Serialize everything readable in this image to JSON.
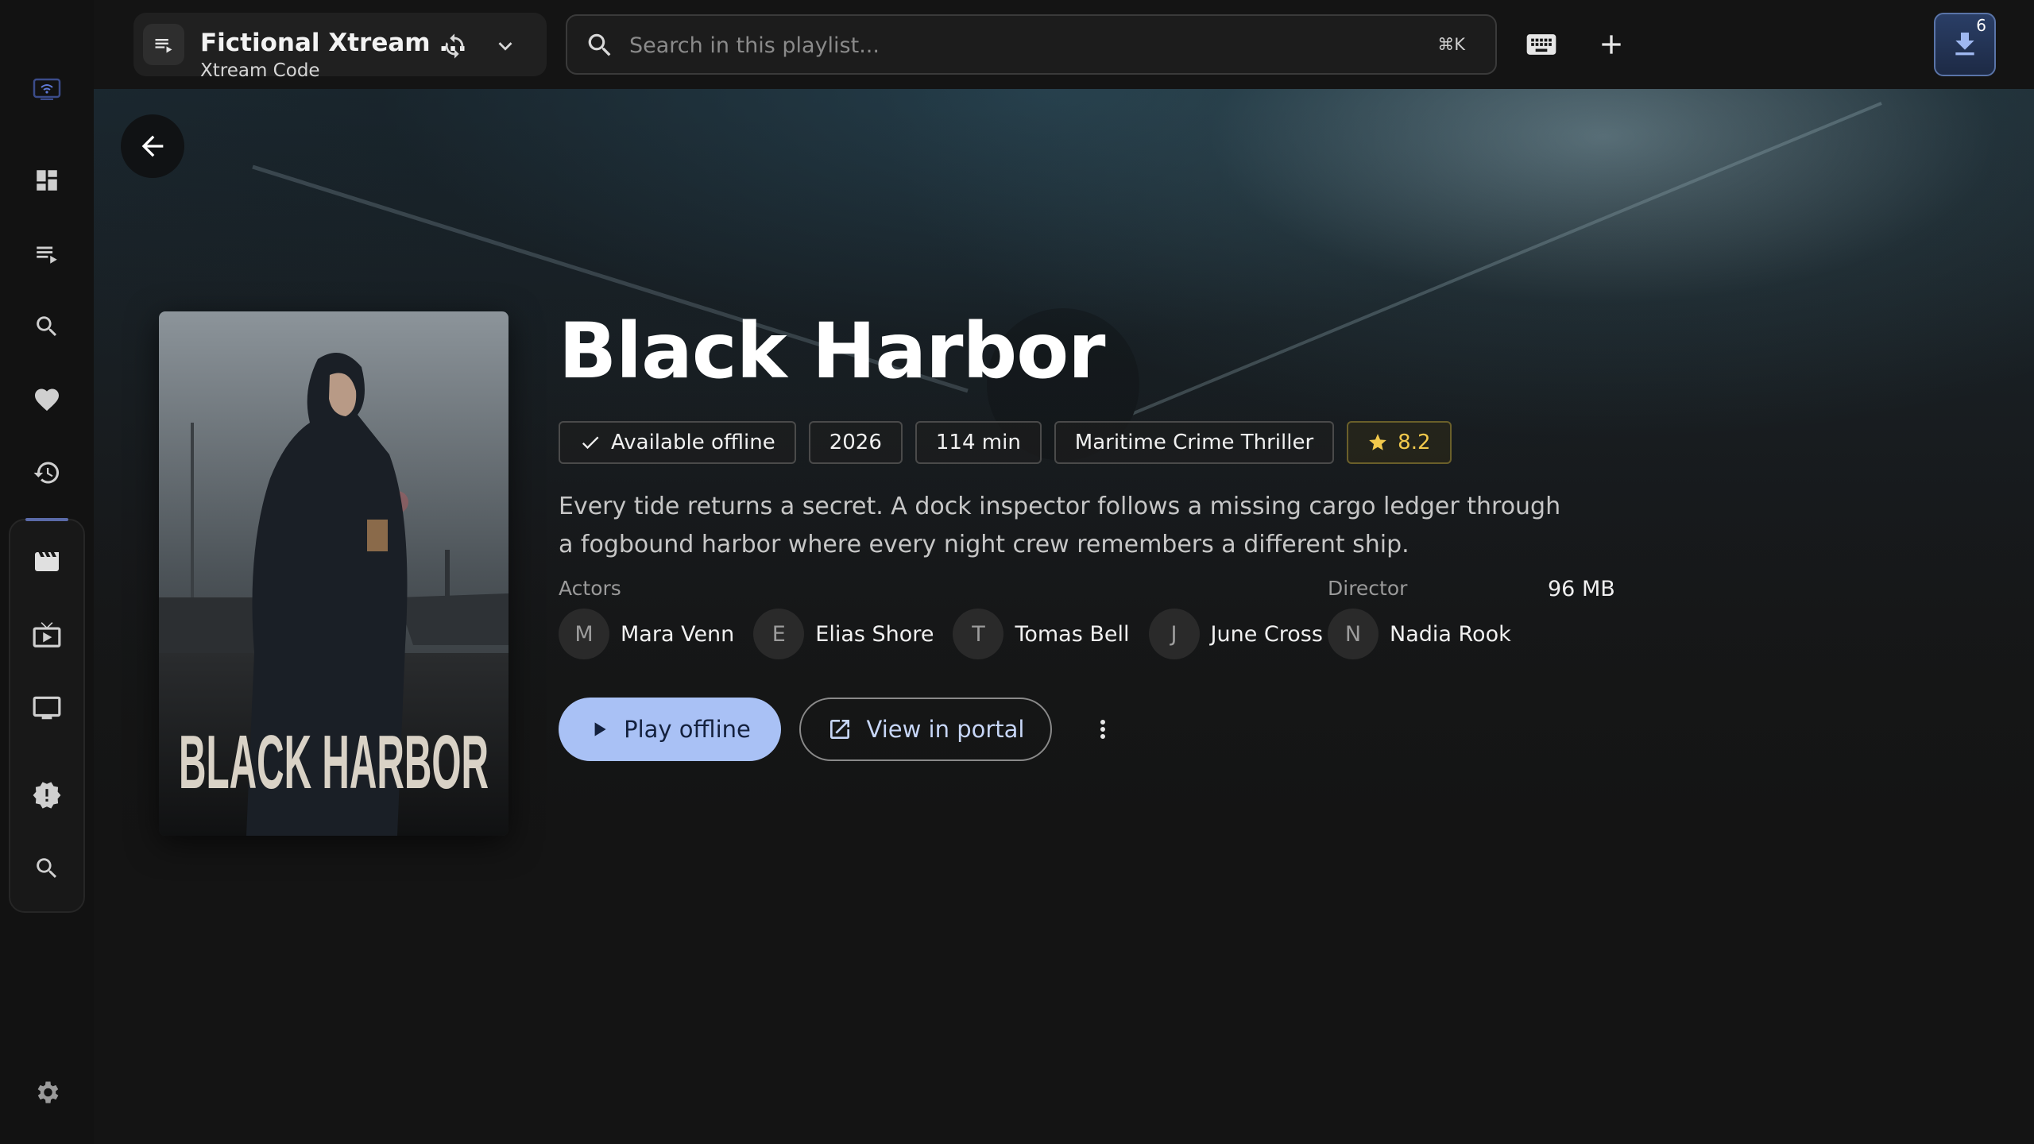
{
  "topbar": {
    "playlist_title": "Fictional Xtream ...",
    "playlist_subtitle": "Xtream Code",
    "search_placeholder": "Search in this playlist...",
    "search_shortcut": "⌘K",
    "downloads_count": "6"
  },
  "movie": {
    "title": "Black Harbor",
    "poster_text": "BLACK HARBOR",
    "chips": {
      "offline": "Available offline",
      "year": "2026",
      "duration": "114 min",
      "genre": "Maritime Crime Thriller",
      "rating": "8.2"
    },
    "description": "Every tide returns a secret. A dock inspector follows a missing cargo ledger through a fogbound harbor where every night crew remembers a different ship.",
    "actors_label": "Actors",
    "actors": [
      {
        "initial": "M",
        "name": "Mara Venn"
      },
      {
        "initial": "E",
        "name": "Elias Shore"
      },
      {
        "initial": "T",
        "name": "Tomas Bell"
      },
      {
        "initial": "J",
        "name": "June Cross"
      }
    ],
    "director_label": "Director",
    "director": {
      "initial": "N",
      "name": "Nadia Rook"
    },
    "file_size": "96 MB",
    "play_label": "Play offline",
    "portal_label": "View in portal"
  },
  "colors": {
    "accent": "#a9c1f5",
    "rating": "#f2c94c",
    "background": "#141414"
  }
}
